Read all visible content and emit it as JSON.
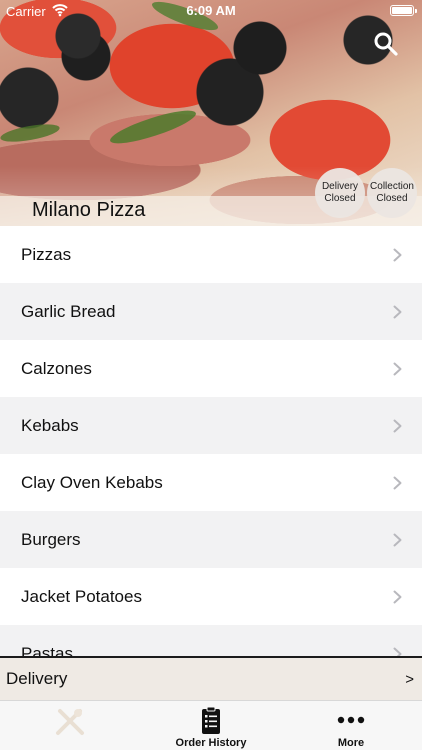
{
  "status_bar": {
    "carrier": "Carrier",
    "time": "6:09 AM"
  },
  "restaurant": {
    "name": "Milano Pizza"
  },
  "badges": {
    "delivery": {
      "line1": "Delivery",
      "line2": "Closed"
    },
    "collection": {
      "line1": "Collection",
      "line2": "Closed"
    }
  },
  "menu": {
    "items": [
      {
        "label": "Pizzas"
      },
      {
        "label": "Garlic Bread"
      },
      {
        "label": "Calzones"
      },
      {
        "label": "Kebabs"
      },
      {
        "label": "Clay Oven Kebabs"
      },
      {
        "label": "Burgers"
      },
      {
        "label": "Jacket Potatoes"
      },
      {
        "label": "Pastas"
      }
    ]
  },
  "delivery_bar": {
    "label": "Delivery",
    "arrow": ">"
  },
  "tabbar": {
    "tabs": [
      {
        "label": "",
        "icon": "home-icon"
      },
      {
        "label": "Order History",
        "icon": "order-history-icon"
      },
      {
        "label": "More",
        "icon": "more-icon"
      }
    ]
  },
  "icons": {
    "search": "search-icon",
    "chevron": "chevron-right-icon",
    "wifi": "wifi-icon",
    "battery": "battery-icon"
  },
  "colors": {
    "list_alt": "#f2f2f3",
    "delivery_bar": "#efeae4",
    "tabbar": "#f7f7f7"
  }
}
